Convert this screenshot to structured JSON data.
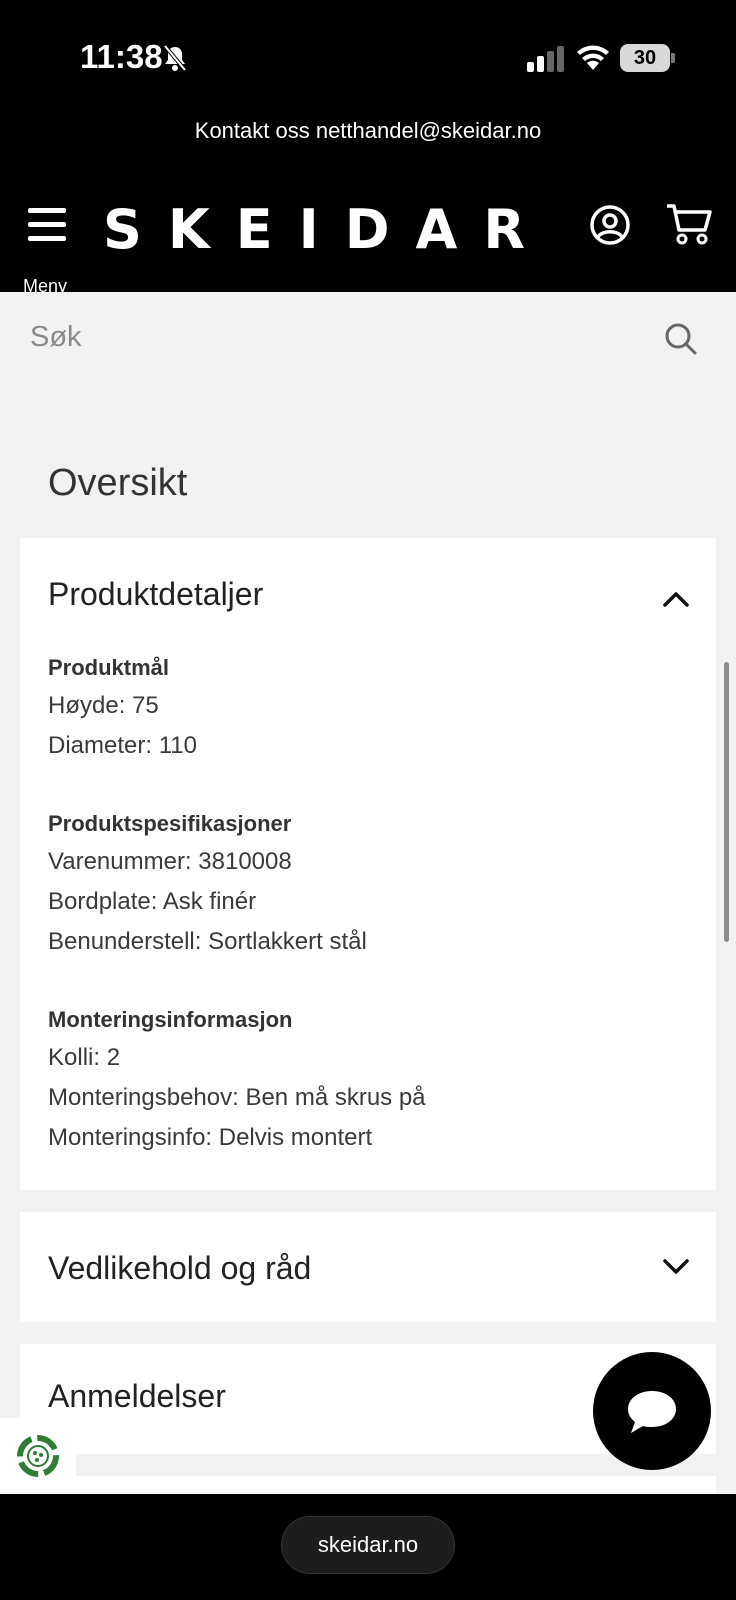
{
  "status_bar": {
    "time": "11:38",
    "battery": "30",
    "icons": [
      "bell-muted-icon",
      "signal-icon",
      "wifi-icon",
      "battery-icon"
    ]
  },
  "contact_banner": "Kontakt oss netthandel@skeidar.no",
  "header": {
    "menu_label": "Meny",
    "logo": "SKEIDAR",
    "icons": [
      "hamburger-icon",
      "account-icon",
      "cart-icon"
    ]
  },
  "search": {
    "placeholder": "Søk",
    "value": ""
  },
  "overview_title": "Oversikt",
  "accordion": {
    "product_details": {
      "title": "Produktdetaljer",
      "expanded": true,
      "groups": [
        {
          "heading": "Produktmål",
          "lines": [
            "Høyde: 75",
            "Diameter: 110"
          ]
        },
        {
          "heading": "Produktspesifikasjoner",
          "lines": [
            "Varenummer: 3810008",
            "Bordplate: Ask finér",
            "Benunderstell: Sortlakkert stål"
          ]
        },
        {
          "heading": "Monteringsinformasjon",
          "lines": [
            "Kolli: 2",
            "Monteringsbehov: Ben må skrus på",
            "Monteringsinfo: Delvis montert"
          ]
        }
      ]
    },
    "maintenance": {
      "title": "Vedlikehold og råd",
      "expanded": false
    },
    "reviews": {
      "title": "Anmeldelser"
    }
  },
  "browser": {
    "url": "skeidar.no"
  },
  "colors": {
    "header_bg": "#000000",
    "page_bg": "#f2f2f2",
    "card_bg": "#ffffff",
    "eco_badge": "#2e7d32"
  }
}
